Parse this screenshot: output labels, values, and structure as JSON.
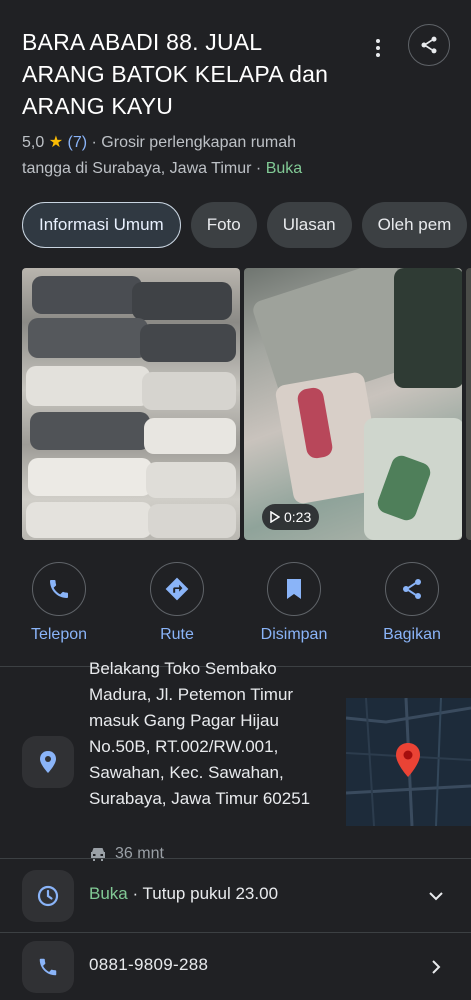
{
  "place": {
    "title": "BARA ABADI 88. JUAL ARANG BATOK KELAPA dan ARANG KAYU",
    "rating": "5,0",
    "star": "★",
    "review_count": "(7)",
    "category": "· Grosir perlengkapan rumah tangga di Surabaya, Jawa Timur ·",
    "status": "Buka"
  },
  "tabs": [
    {
      "label": "Informasi Umum",
      "active": true
    },
    {
      "label": "Foto"
    },
    {
      "label": "Ulasan"
    },
    {
      "label": "Oleh pem"
    }
  ],
  "photos": {
    "video_duration": "0:23"
  },
  "actions": [
    {
      "label": "Telepon",
      "icon": "phone-icon"
    },
    {
      "label": "Rute",
      "icon": "directions-icon"
    },
    {
      "label": "Disimpan",
      "icon": "bookmark-icon"
    },
    {
      "label": "Bagikan",
      "icon": "share-icon"
    }
  ],
  "address": {
    "text": "Belakang Toko Sembako Madura, Jl. Petemon Timur masuk Gang Pagar Hijau No.50B, RT.002/RW.001, Sawahan, Kec. Sawahan, Surabaya, Jawa Timur 60251",
    "travel_time": "36 mnt"
  },
  "hours": {
    "status": "Buka",
    "detail": " · Tutup pukul 23.00"
  },
  "phone": {
    "number": "0881-9809-288"
  },
  "colors": {
    "background": "#202124",
    "accent": "#8ab4f8",
    "open": "#81c995",
    "star": "#fbbc04",
    "map_pin": "#ea4335"
  }
}
